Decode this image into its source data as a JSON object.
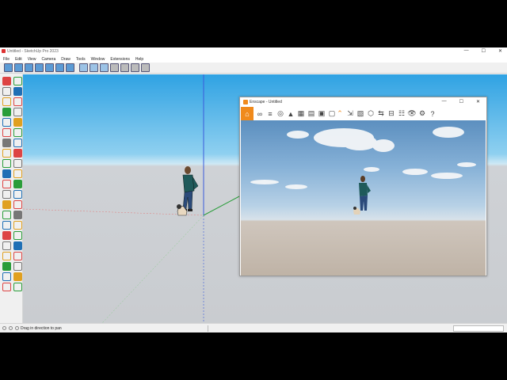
{
  "window": {
    "title": "Untitled - SketchUp Pro 2023",
    "controls": [
      "—",
      "☐",
      "✕"
    ]
  },
  "menu": [
    "File",
    "Edit",
    "View",
    "Camera",
    "Draw",
    "Tools",
    "Window",
    "Extensions",
    "Help"
  ],
  "toolbar_icons": [
    "iso-view-icon",
    "top-view-icon",
    "front-view-icon",
    "right-view-icon",
    "back-view-icon",
    "left-view-icon",
    "bottom-view-icon",
    "xray-icon",
    "back-edges-icon",
    "wireframe-icon",
    "hidden-line-icon",
    "shaded-icon",
    "shaded-textures-icon",
    "monochrome-icon"
  ],
  "tool_palette": [
    "select-icon",
    "component-icon",
    "paint-bucket-icon",
    "eraser-icon",
    "tag-icon",
    "eraser2-icon",
    "line-icon",
    "freehand-icon",
    "rectangle-icon",
    "rotated-rect-icon",
    "circle-icon",
    "polygon-icon",
    "arc-icon",
    "arc2-icon",
    "pie-icon",
    "arc3-icon",
    "push-pull-icon",
    "follow-me-icon",
    "move-icon",
    "offset-icon",
    "rotate-icon",
    "scale-icon",
    "tape-icon",
    "protractor-icon",
    "dimension-icon",
    "text-icon",
    "axes-icon",
    "3d-text-icon",
    "orbit-icon",
    "pan-icon",
    "zoom-icon",
    "zoom-window-icon",
    "zoom-extents-icon",
    "previous-view-icon",
    "walk-icon",
    "look-around-icon",
    "position-camera-icon",
    "section-plane-icon",
    "sandbox-icon",
    "sandbox2-icon",
    "display-section-icon",
    "section-cuts-icon"
  ],
  "status": {
    "hint": "Drag in direction to pan",
    "measure": ""
  },
  "enscape": {
    "title": "Enscape - Untitled",
    "controls": [
      "—",
      "☐",
      "✕"
    ],
    "toolbar_icons": [
      "home-icon",
      "link-icon",
      "list-icon",
      "binoculars-icon",
      "mountain-icon",
      "buildings-icon",
      "clapper-icon",
      "monitor-icon",
      "document-icon",
      "chevron-up-icon",
      "export-icon",
      "panorama-icon",
      "cube-icon",
      "share-icon",
      "asset-icon",
      "collab-icon",
      "eye-icon",
      "settings-icon",
      "help-icon"
    ]
  },
  "colors": {
    "sky_top": "#2fa2e3",
    "ground": "#c9ccd0",
    "enscape_orange": "#f08a1c",
    "axis_blue": "#3b5bdb",
    "axis_red": "#d33",
    "axis_green": "#2a9d3a"
  }
}
